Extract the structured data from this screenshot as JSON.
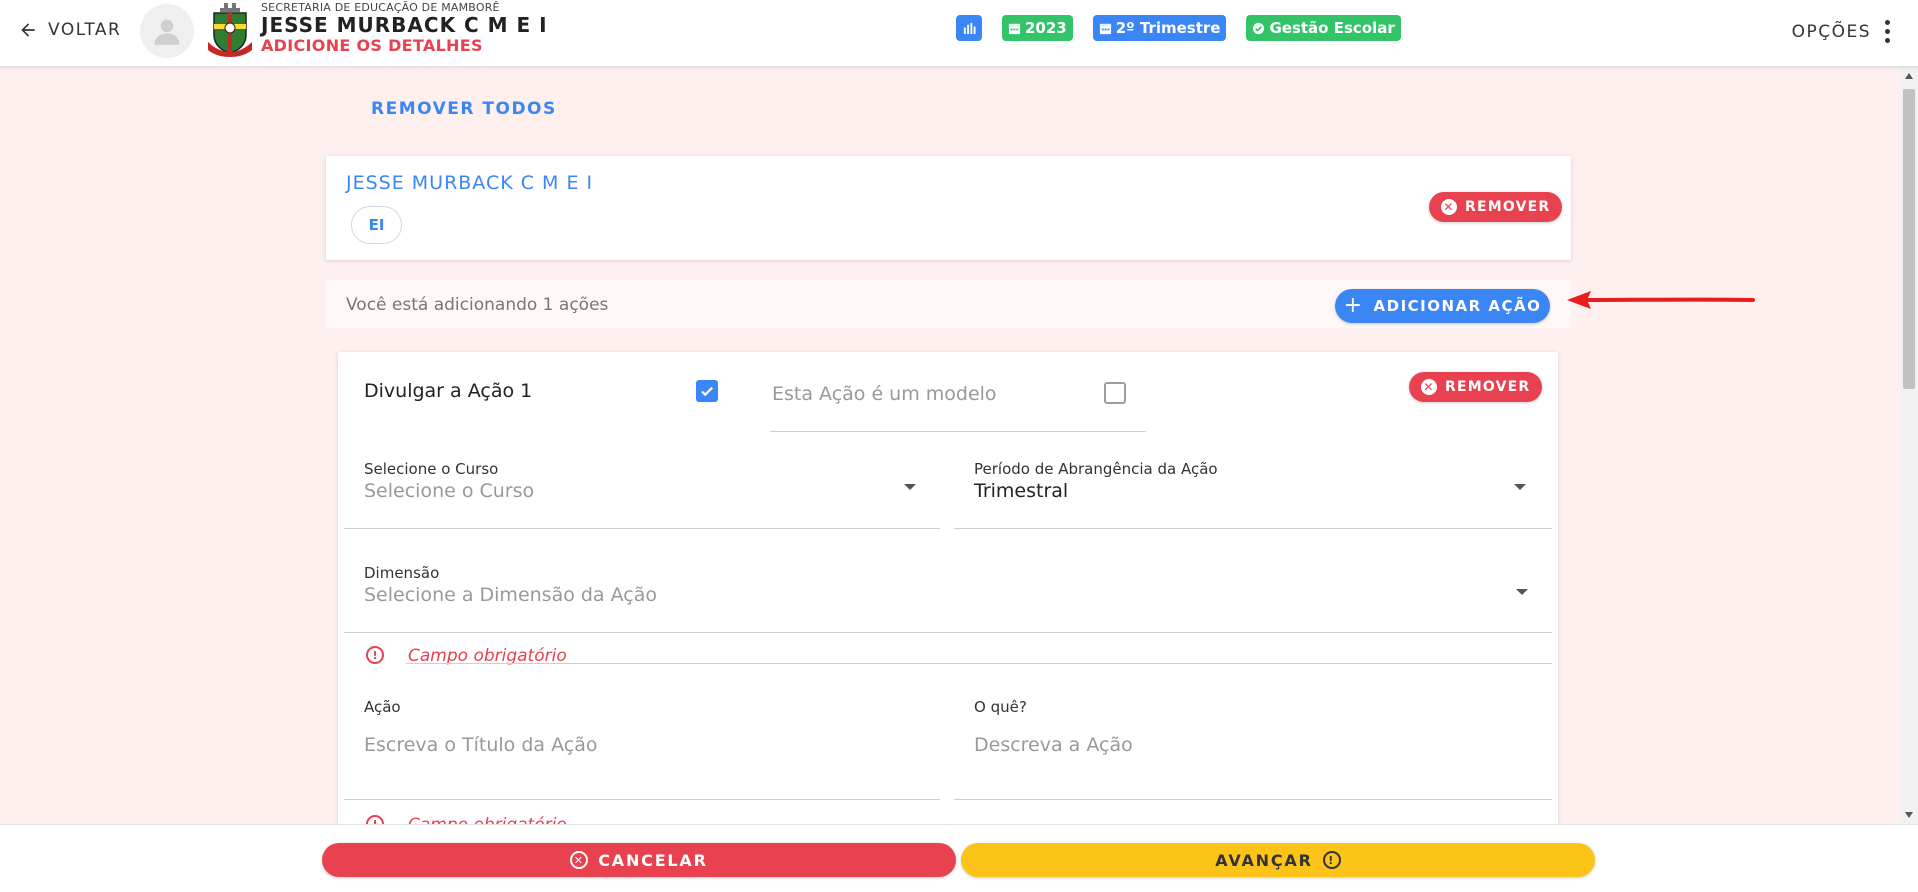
{
  "header": {
    "back_label": "VOLTAR",
    "department": "SECRETARIA DE EDUCAÇÃO DE MAMBORÊ",
    "school_name": "JESSE MURBACK C M E I",
    "subtitle": "ADICIONE OS DETALHES",
    "badges": [
      {
        "icon": "bar-chart-icon",
        "label": "",
        "color": "#3b86f5"
      },
      {
        "icon": "calendar-icon",
        "label": "2023",
        "color": "#33c46a"
      },
      {
        "icon": "calendar-icon",
        "label": "2º Trimestre",
        "color": "#3b86f5"
      },
      {
        "icon": "check-circle-icon",
        "label": "Gestão Escolar",
        "color": "#33c46a"
      }
    ],
    "options_label": "OPÇÕES"
  },
  "main": {
    "remove_all_label": "REMOVER TODOS",
    "school_card": {
      "title": "JESSE MURBACK C M E I",
      "chip": "EI",
      "remove_label": "REMOVER"
    },
    "add_bar": {
      "text": "Você está adicionando 1 ações",
      "add_label": "ADICIONAR AÇÃO"
    },
    "action": {
      "publish_label": "Divulgar a Ação 1",
      "publish_checked": true,
      "model_label": "Esta Ação é um modelo",
      "model_checked": false,
      "remove_label": "REMOVER",
      "course": {
        "label": "Selecione o Curso",
        "placeholder": "Selecione o Curso"
      },
      "period": {
        "label": "Período de Abrangência da Ação",
        "value": "Trimestral"
      },
      "dimension": {
        "label": "Dimensão",
        "placeholder": "Selecione a Dimensão da Ação",
        "error": "Campo obrigatório"
      },
      "title": {
        "label": "Ação",
        "placeholder": "Escreva o Título da Ação",
        "error": "Campo obrigatório"
      },
      "what": {
        "label": "O quê?",
        "placeholder": "Descreva a Ação"
      }
    }
  },
  "footer": {
    "cancel_label": "CANCELAR",
    "next_label": "AVANÇAR"
  },
  "colors": {
    "primary": "#3b86f5",
    "danger": "#e8414f",
    "success": "#33c46a",
    "warning": "#fcc419",
    "background": "#fdf0ef"
  }
}
